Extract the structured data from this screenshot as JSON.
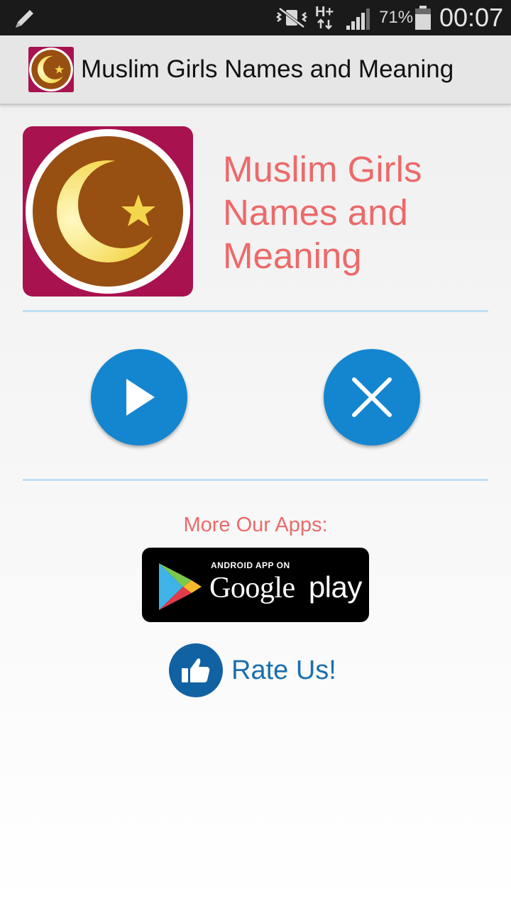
{
  "status_bar": {
    "battery_percent": "71%",
    "time": "00:07",
    "network_type": "H+",
    "icons": [
      "pencil-icon",
      "vibrate-icon",
      "network-data-icon",
      "signal-icon",
      "battery-icon"
    ]
  },
  "action_bar": {
    "title": "Muslim Girls Names and Meaning",
    "app_icon": "crescent-star-icon"
  },
  "header": {
    "title": "Muslim Girls Names and Meaning",
    "icon": "crescent-star-icon"
  },
  "buttons": {
    "start": "play-icon",
    "exit": "close-icon"
  },
  "more_apps": {
    "label": "More Our Apps:",
    "badge_small": "ANDROID APP ON",
    "badge_big": "Google",
    "badge_play": "play"
  },
  "rate": {
    "label": "Rate Us!",
    "icon": "thumbs-up-icon"
  },
  "colors": {
    "accent_red": "#ec6a6a",
    "button_blue": "#1486d0",
    "rate_blue": "#1b6fae",
    "icon_magenta": "#a8134f",
    "icon_brown": "#984f12"
  }
}
